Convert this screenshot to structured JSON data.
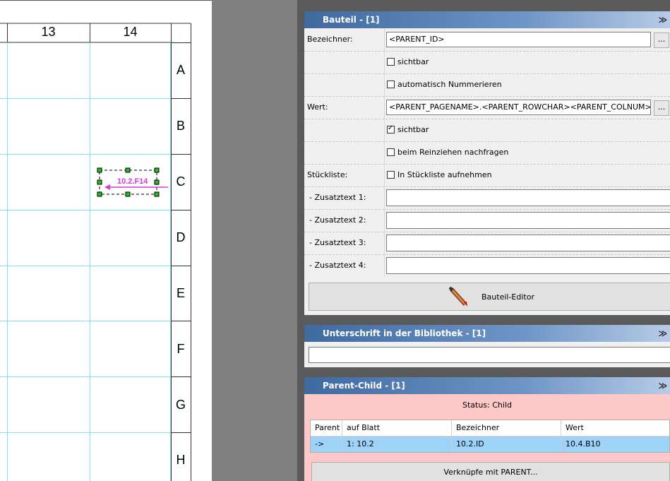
{
  "sheet": {
    "columns": [
      "13",
      "14"
    ],
    "rows": [
      "A",
      "B",
      "C",
      "D",
      "E",
      "F",
      "G",
      "H"
    ],
    "symbol_label": "10.2.F14"
  },
  "panel": {
    "bauteil": {
      "title": "Bauteil  -  [1]",
      "chevron": "≫",
      "bezeichner_label": "Bezeichner:",
      "bezeichner_value": "<PARENT_ID>",
      "dots": "...",
      "sichtbar1": {
        "label": "sichtbar",
        "checked": false
      },
      "auto_num": {
        "label": "automatisch Nummerieren",
        "checked": false
      },
      "wert_label": "Wert:",
      "wert_value": "<PARENT_PAGENAME>.<PARENT_ROWCHAR><PARENT_COLNUM>",
      "sichtbar2": {
        "label": "sichtbar",
        "checked": true
      },
      "reinziehen": {
        "label": "beim Reinziehen nachfragen",
        "checked": false
      },
      "stueckliste_label": "Stückliste:",
      "in_stueckliste": {
        "label": "In Stückliste aufnehmen",
        "checked": false
      },
      "zusatz": [
        "- Zusatztext 1:",
        "- Zusatztext 2:",
        "- Zusatztext 3:",
        "- Zusatztext 4:"
      ],
      "editor_button": "Bauteil-Editor"
    },
    "unterschrift": {
      "title": "Unterschrift in der Bibliothek  -  [1]",
      "chevron": "≫",
      "value": ""
    },
    "parent_child": {
      "title": "Parent-Child  -  [1]",
      "chevron": "≫",
      "status": "Status: Child",
      "columns": [
        "Parent",
        "auf Blatt",
        "Bezeichner",
        "Wert"
      ],
      "rows": [
        [
          "->",
          "1: 10.2",
          "10.2.ID",
          "10.4.B10"
        ]
      ],
      "link_button": "Verknüpfe mit PARENT..."
    }
  },
  "colors": {
    "symbol": "#d23cd2",
    "grid": "#7fe0f0",
    "header_start": "#3f6aa0",
    "status_bg": "#ffc8c8",
    "selection": "#9fd2f7"
  }
}
